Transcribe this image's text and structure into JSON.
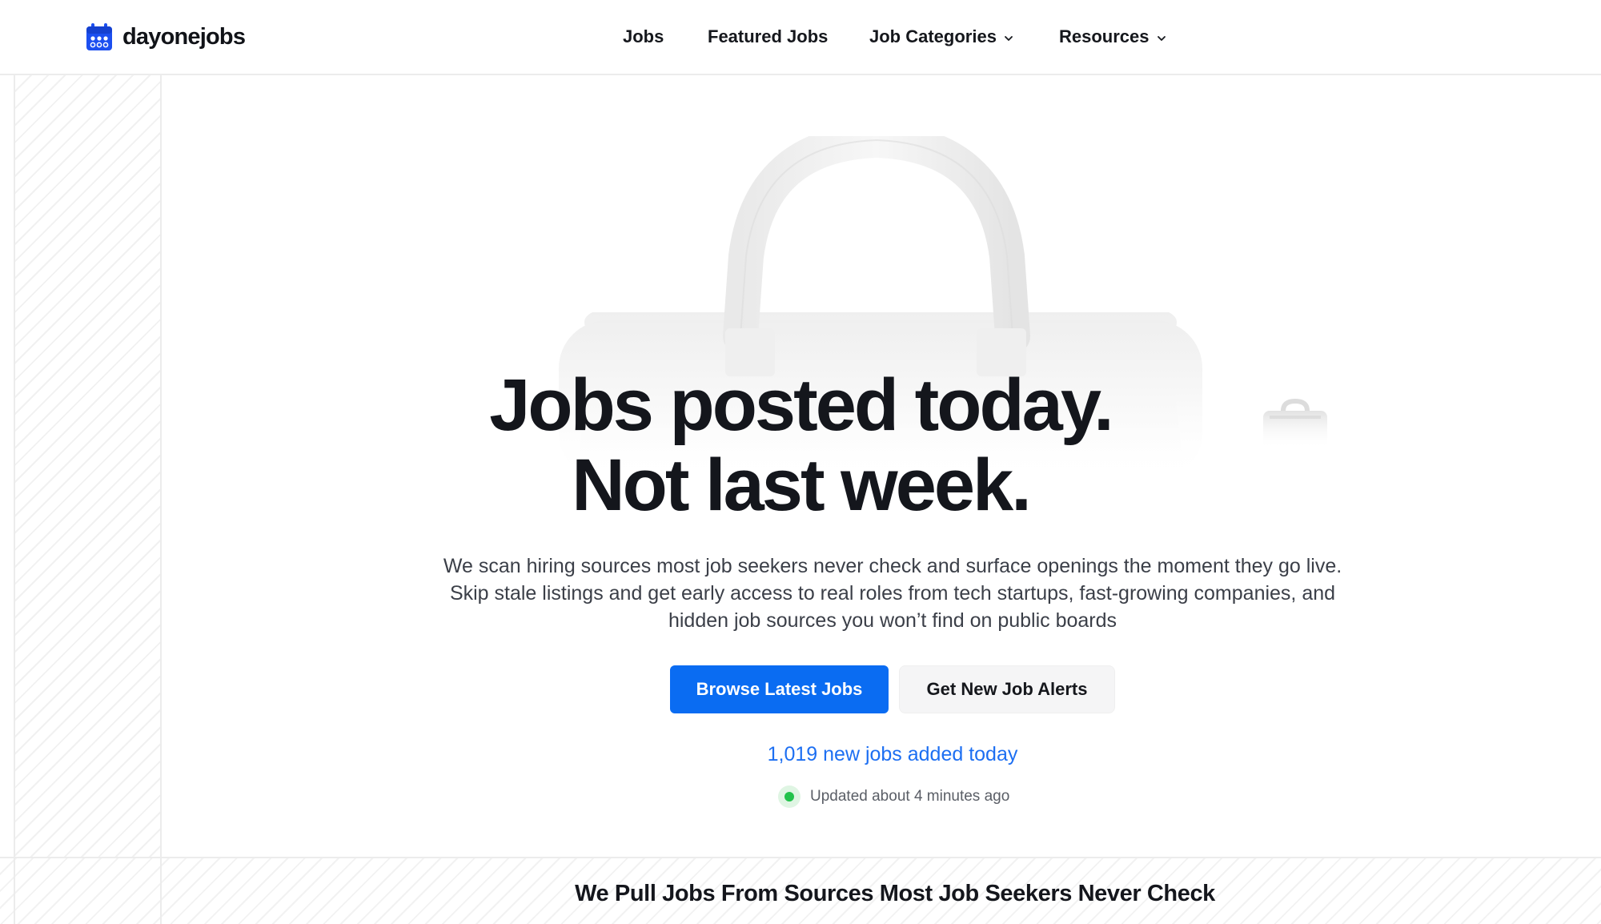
{
  "brand": {
    "name": "dayonejobs",
    "accent_color": "#0a6cf2",
    "logo_icon": "calendar-icon"
  },
  "nav": {
    "items": [
      {
        "label": "Jobs",
        "has_dropdown": false
      },
      {
        "label": "Featured Jobs",
        "has_dropdown": false
      },
      {
        "label": "Job Categories",
        "has_dropdown": true,
        "icon": "chevron-down-icon"
      },
      {
        "label": "Resources",
        "has_dropdown": true,
        "icon": "chevron-down-icon"
      }
    ]
  },
  "hero": {
    "headline_line1": "Jobs posted today.",
    "headline_line2": "Not last week.",
    "subtext_lines": [
      "We scan hiring sources most job seekers never check and surface openings the moment they go live.",
      "Skip stale listings and get early access to real roles from tech startups, fast-growing companies, and",
      "hidden job sources you won’t find on public boards"
    ],
    "primary_button": "Browse Latest Jobs",
    "secondary_button": "Get New Job Alerts",
    "new_jobs_text": "1,019 new jobs added today",
    "updated_text": "Updated about 4 minutes ago",
    "status_color": "#22c24b",
    "decoration_icons": [
      "briefcase-icon",
      "briefcase-icon"
    ]
  },
  "section": {
    "title": "We Pull Jobs From Sources Most Job Seekers Never Check"
  }
}
